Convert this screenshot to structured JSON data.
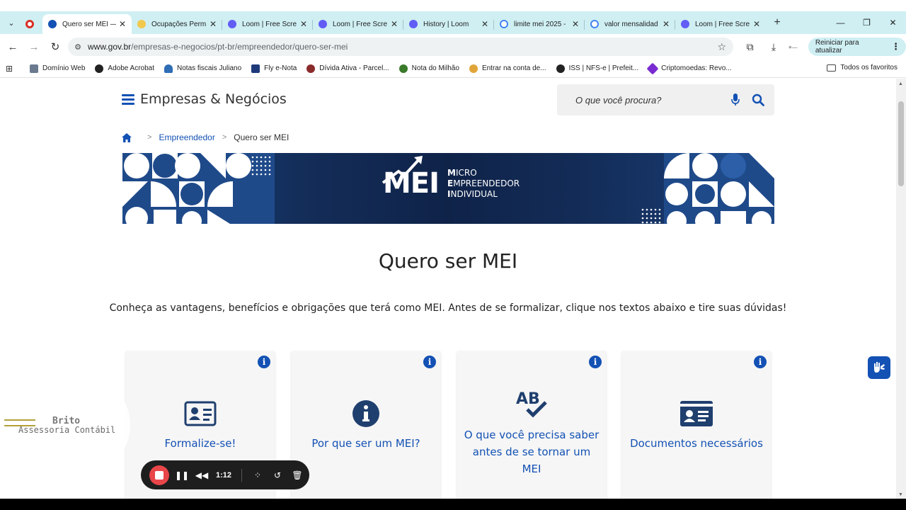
{
  "browser": {
    "tabs": [
      {
        "title": "",
        "favicon_color": "#d93025",
        "active": false
      },
      {
        "title": "Quero ser MEI —",
        "favicon_color": "#1351b4",
        "active": true
      },
      {
        "title": "Ocupações Perm",
        "favicon_color": "#1351b4",
        "active": false
      },
      {
        "title": "Loom | Free Scre",
        "favicon_color": "#625df5",
        "active": false
      },
      {
        "title": "Loom | Free Scre",
        "favicon_color": "#625df5",
        "active": false
      },
      {
        "title": "History | Loom",
        "favicon_color": "#625df5",
        "active": false
      },
      {
        "title": "limite mei 2025 -",
        "favicon_color": "#4285f4",
        "active": false
      },
      {
        "title": "valor mensalidad",
        "favicon_color": "#4285f4",
        "active": false
      },
      {
        "title": "Loom | Free Scre",
        "favicon_color": "#625df5",
        "active": false
      }
    ],
    "url_host": "www.gov.br",
    "url_path": "/empresas-e-negocios/pt-br/empreendedor/quero-ser-mei",
    "update_button": "Reiniciar para atualizar",
    "bookmarks": [
      {
        "label": "Domínio Web",
        "color": "#6b7a8f"
      },
      {
        "label": "Adobe Acrobat",
        "color": "#222222"
      },
      {
        "label": "Notas fiscais Juliano",
        "color": "#2f6db5"
      },
      {
        "label": "Fly e-Nota",
        "color": "#1e3a7a"
      },
      {
        "label": "Dívida Ativa - Parcel...",
        "color": "#8a2b2b"
      },
      {
        "label": "Nota do Milhão",
        "color": "#3a7a2b"
      },
      {
        "label": "Entrar na conta de...",
        "color": "#e0a53a"
      },
      {
        "label": "ISS | NFS-e | Prefeit...",
        "color": "#222222"
      },
      {
        "label": "Criptomoedas: Revo...",
        "color": "#7a2bd1"
      }
    ],
    "all_bookmarks": "Todos os favoritos"
  },
  "site": {
    "title": "Empresas & Negócios",
    "search_placeholder": "O que você procura?",
    "breadcrumb": {
      "parent": "Empreendedor",
      "current": "Quero ser MEI"
    },
    "banner": {
      "mark": "MEI",
      "line1_initial": "M",
      "line1_rest": "ICRO",
      "line2_initial": "E",
      "line2_rest": "MPREENDEDOR",
      "line3_initial": "I",
      "line3_rest": "NDIVIDUAL"
    },
    "heading": "Quero ser MEI",
    "lead": "Conheça as vantagens, benefícios e obrigações que terá como MEI. Antes de se formalizar, clique nos textos abaixo e tire suas dúvidas!",
    "cards": [
      {
        "label": "Formalize-se!",
        "icon": "id-card-icon"
      },
      {
        "label": "Por que ser um MEI?",
        "icon": "info-circle-icon"
      },
      {
        "label": "O que você precisa saber antes de se tornar um MEI",
        "icon": "ab-check-icon"
      },
      {
        "label": "Documentos necessários",
        "icon": "documents-icon"
      }
    ],
    "colors": {
      "primary": "#1351b4",
      "banner": "#132c57"
    }
  },
  "watermark": {
    "line1": "Brito",
    "line2": "Assessoria Contábil"
  },
  "recorder": {
    "time": "1:12"
  }
}
